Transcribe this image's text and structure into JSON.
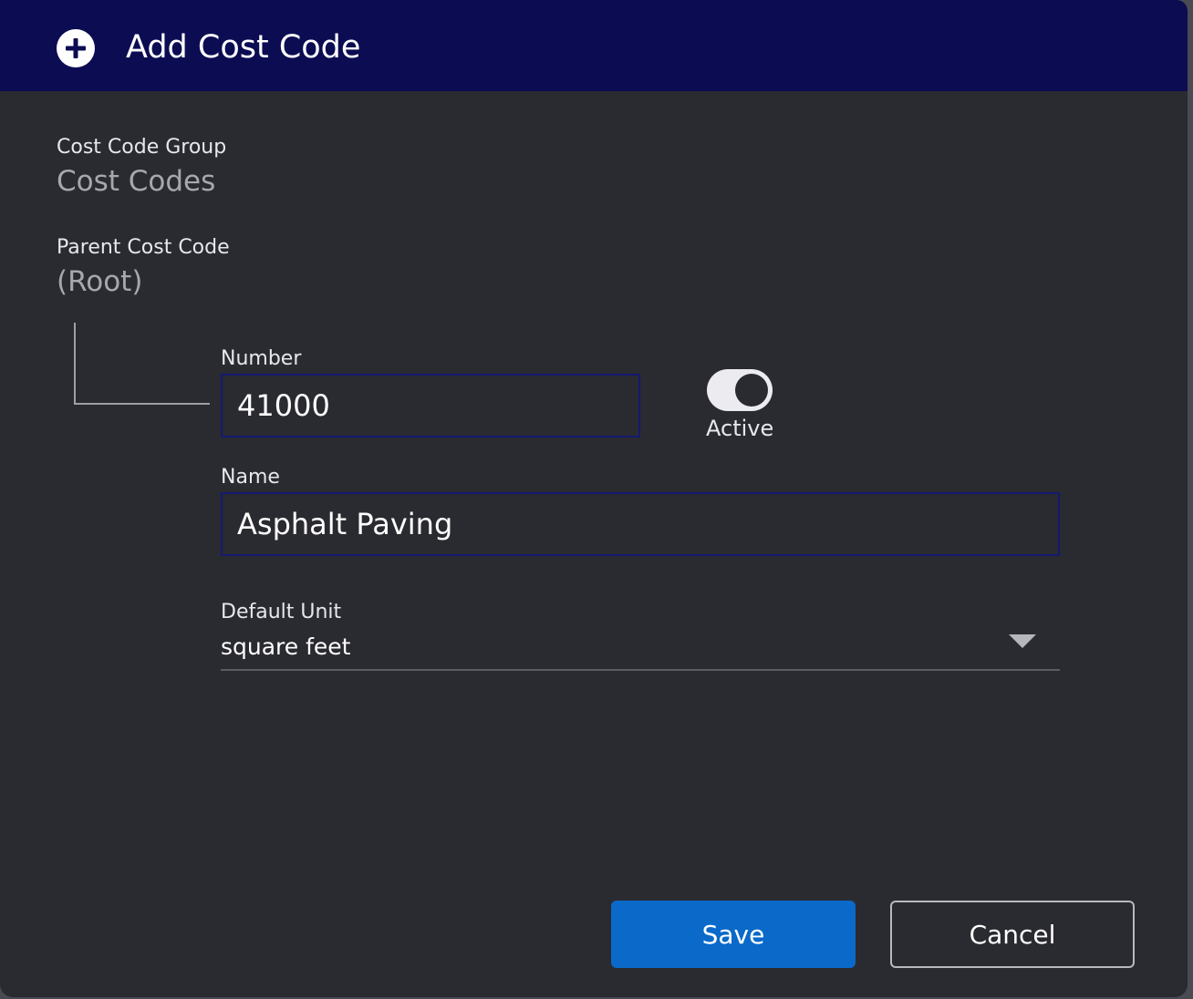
{
  "dialog": {
    "title": "Add Cost Code",
    "title_icon": "plus-circle-icon"
  },
  "cost_code_group": {
    "label": "Cost Code Group",
    "value": "Cost Codes"
  },
  "parent_cost_code": {
    "label": "Parent Cost Code",
    "value": "(Root)"
  },
  "number": {
    "label": "Number",
    "value": "41000"
  },
  "active_toggle": {
    "label": "Active",
    "on": true
  },
  "name": {
    "label": "Name",
    "value": "Asphalt Paving"
  },
  "default_unit": {
    "label": "Default Unit",
    "value": "square feet",
    "icon": "caret-down-icon"
  },
  "buttons": {
    "save_label": "Save",
    "cancel_label": "Cancel"
  },
  "colors": {
    "titlebar": "#0b0c52",
    "background": "#2a2a31",
    "accent": "#0a69c9",
    "input_border": "#151a70"
  }
}
